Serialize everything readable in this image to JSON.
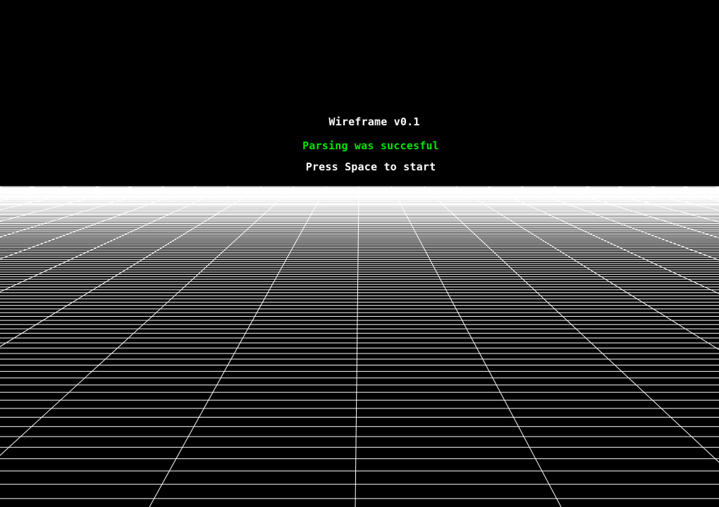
{
  "title": "Wireframe v0.1",
  "status_message": "Parsing was succesful",
  "prompt": "Press Space to start",
  "colors": {
    "background": "#000000",
    "title": "#ffffff",
    "status_success": "#00e600",
    "prompt": "#ffffff",
    "grid_line": "#ffffff"
  }
}
